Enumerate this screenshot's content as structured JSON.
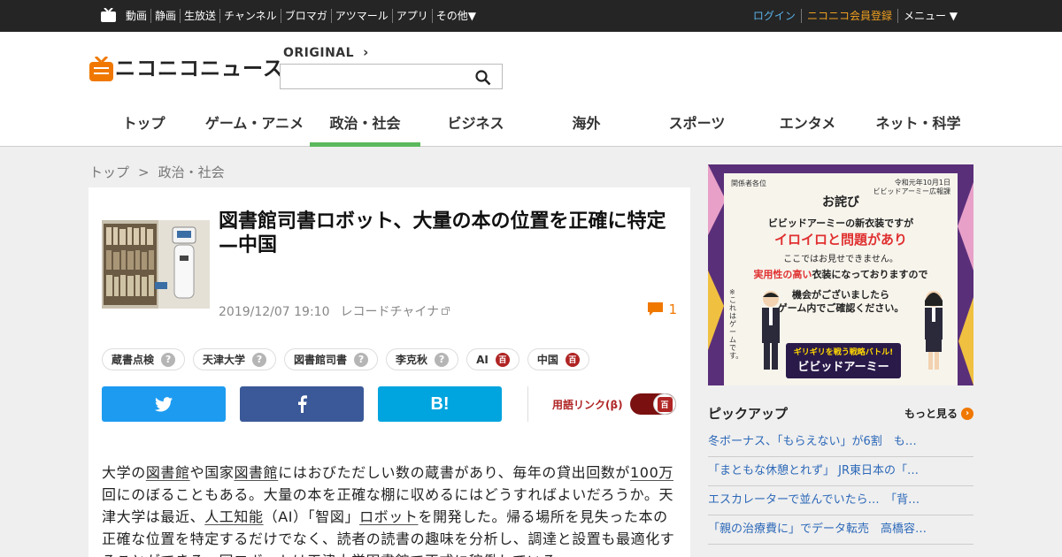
{
  "topbar": {
    "links": [
      "動画",
      "静画",
      "生放送",
      "チャンネル",
      "ブロマガ",
      "アツマール",
      "アプリ",
      "その他▼"
    ],
    "login": "ログイン",
    "register": "ニコニコ会員登録",
    "menu": "メニュー ▼"
  },
  "header": {
    "logo_text": "ニコニコニュース",
    "original_label": "ORIGINAL",
    "search_placeholder": "",
    "nav": [
      "トップ",
      "ゲーム・アニメ",
      "政治・社会",
      "ビジネス",
      "海外",
      "スポーツ",
      "エンタメ",
      "ネット・科学"
    ],
    "active_nav": "政治・社会"
  },
  "breadcrumb": [
    "トップ",
    "政治・社会"
  ],
  "breadcrumb_sep": ">",
  "article": {
    "title": "図書館司書ロボット、大量の本の位置を正確に特定—中国",
    "date": "2019/12/07 19:10",
    "source": "レコードチャイナ",
    "comment_count": "1",
    "tags": [
      {
        "label": "蔵書点検",
        "type": "question"
      },
      {
        "label": "天津大学",
        "type": "question"
      },
      {
        "label": "図書館司書",
        "type": "question"
      },
      {
        "label": "李克秋",
        "type": "question"
      },
      {
        "label": "AI",
        "type": "hyakka"
      },
      {
        "label": "中国",
        "type": "hyakka"
      }
    ],
    "share": {
      "hatena_label": "B!"
    },
    "link_mode_label": "用語リンク(β)",
    "hyakka_glyph": "百",
    "question_glyph": "?",
    "body": {
      "p1": "大学の",
      "k1": "図書館",
      "p2": "や国家",
      "k2": "図書館",
      "p3": "にはおびただしい数の蔵書があり、毎年の貸出回数が",
      "k3": "100万",
      "p4": "回にのぼることもある。大量の本を正確な棚に収めるにはどうすればよいだろうか。天津大学は最近、",
      "k4": "人工知能",
      "p5": "（AI）「智図」",
      "k5": "ロボット",
      "p6": "を開発した。帰る場所を見失った本の正確な位置を特定するだけでなく、読者の読書の趣味を分析し、調達と設置も最適化することができる。同ロボットは天津大学図書館で正式に稼働している。"
    }
  },
  "ad": {
    "left_top": "関係者各位",
    "right_top_1": "令和元年10月1日",
    "right_top_2": "ビビッドアーミー広報課",
    "title": "お詫び",
    "line1": "ビビッドアーミーの新衣装ですが",
    "line2": "イロイロと問題があり",
    "line3": "ここではお見せできません。",
    "line4_red": "実用性の高い",
    "line4_rest": "衣装になっておりますので",
    "line5a": "機会がございましたら",
    "line5b": "ゲーム内でご確認ください。",
    "side_note": "※これはゲームです。",
    "banner_top": "ギリギリを戦う戦略バトル!",
    "banner_name": "ビビッドアーミー"
  },
  "pickup": {
    "title": "ピックアップ",
    "more": "もっと見る",
    "more_glyph": "›",
    "items": [
      "冬ボーナス、「もらえない」が6割　も…",
      "「まともな休憩とれず」 JR東日本の「…",
      "エスカレーターで並んでいたら…　「背…",
      "「親の治療費に」でデータ転売　高橋容…"
    ]
  },
  "colors": {
    "topbar_bg": "#252525",
    "active_nav": "#5cb85c",
    "twitter": "#1d9bf0",
    "facebook": "#3b5998",
    "hatena": "#00a4de",
    "accent_orange": "#f07800",
    "link_blue": "#2c68b8",
    "hyakka_red": "#b02424"
  }
}
